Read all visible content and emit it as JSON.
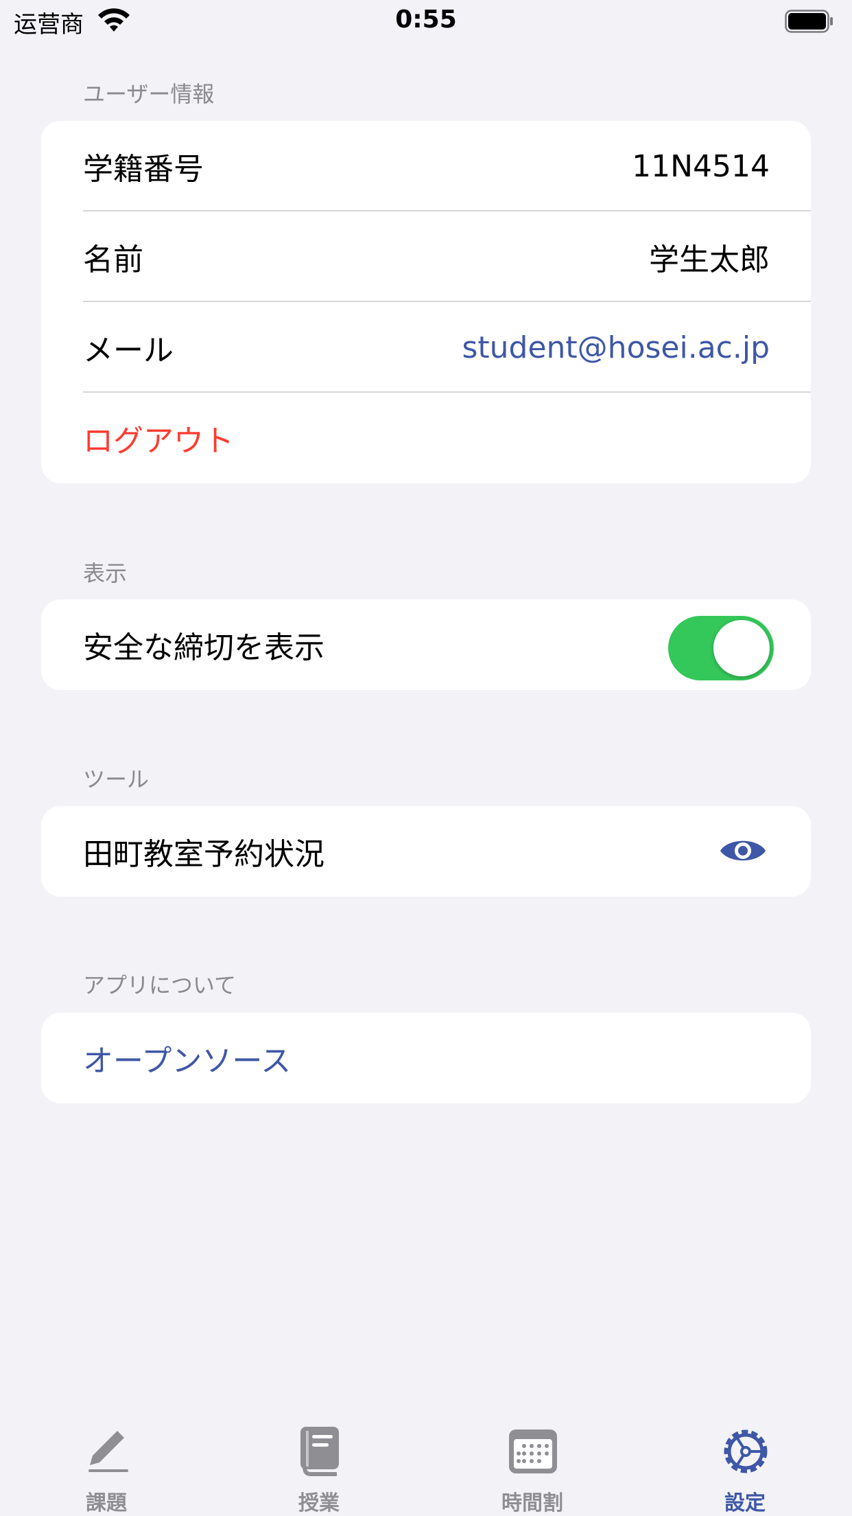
{
  "status_bar": {
    "carrier": "运营商",
    "time": "0:55"
  },
  "sections": {
    "user_info": {
      "header": "ユーザー情報",
      "rows": [
        {
          "label": "学籍番号",
          "value": "11N4514"
        },
        {
          "label": "名前",
          "value": "学生太郎"
        },
        {
          "label": "メール",
          "value": "student@hosei.ac.jp"
        }
      ],
      "logout_label": "ログアウト"
    },
    "display": {
      "header": "表示",
      "toggle_label": "安全な締切を表示",
      "toggle_on": true
    },
    "tools": {
      "header": "ツール",
      "row_label": "田町教室予約状況",
      "icon": "eye-icon"
    },
    "about": {
      "header": "アプリについて",
      "row_label": "オープンソース"
    }
  },
  "tab_bar": {
    "tabs": [
      {
        "label": "課題",
        "icon": "pencil-icon",
        "active": false
      },
      {
        "label": "授業",
        "icon": "book-icon",
        "active": false
      },
      {
        "label": "時間割",
        "icon": "calendar-icon",
        "active": false
      },
      {
        "label": "設定",
        "icon": "gear-icon",
        "active": true
      }
    ]
  },
  "colors": {
    "accent": "#3e57a6",
    "danger": "#ff3b30",
    "toggle_on": "#34c759",
    "background": "#f2f2f7",
    "inactive_tab": "#8e8e93"
  }
}
